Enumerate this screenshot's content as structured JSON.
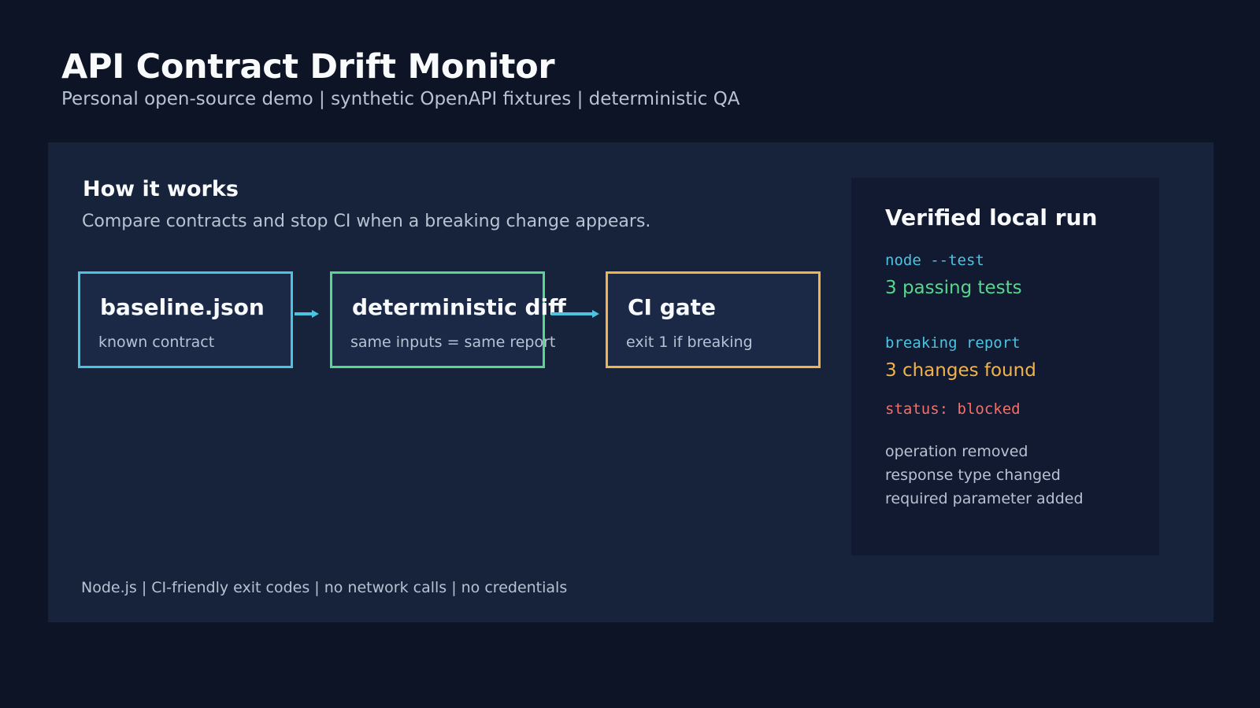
{
  "header": {
    "title": "API Contract Drift Monitor",
    "subtitle": "Personal open-source demo | synthetic OpenAPI fixtures | deterministic QA"
  },
  "how_it_works": {
    "title": "How it works",
    "description": "Compare contracts and stop CI when a breaking change appears."
  },
  "flow": [
    {
      "title": "baseline.json",
      "subtitle": "known contract",
      "border_color": "#4cc3e0"
    },
    {
      "title": "deterministic diff",
      "subtitle": "same inputs = same report",
      "border_color": "#57d68d"
    },
    {
      "title": "CI gate",
      "subtitle": "exit 1 if breaking",
      "border_color": "#f3b34b"
    }
  ],
  "verified_run": {
    "title": "Verified local run",
    "test_command": "node --test",
    "test_result": "3 passing tests",
    "report_label": "breaking report",
    "report_result": "3 changes found",
    "status": "status: blocked",
    "changes": [
      "operation removed",
      "response type changed",
      "required parameter added"
    ]
  },
  "footer": {
    "text": "Node.js | CI-friendly exit codes | no network calls | no credentials"
  },
  "colors": {
    "background": "#0d1425",
    "panel": "#17223b",
    "accent_cyan": "#4cc3e0",
    "accent_green": "#57d68d",
    "accent_orange": "#f3b34b",
    "status_red": "#f0706a"
  },
  "icons": [
    "arrow-right-icon"
  ]
}
